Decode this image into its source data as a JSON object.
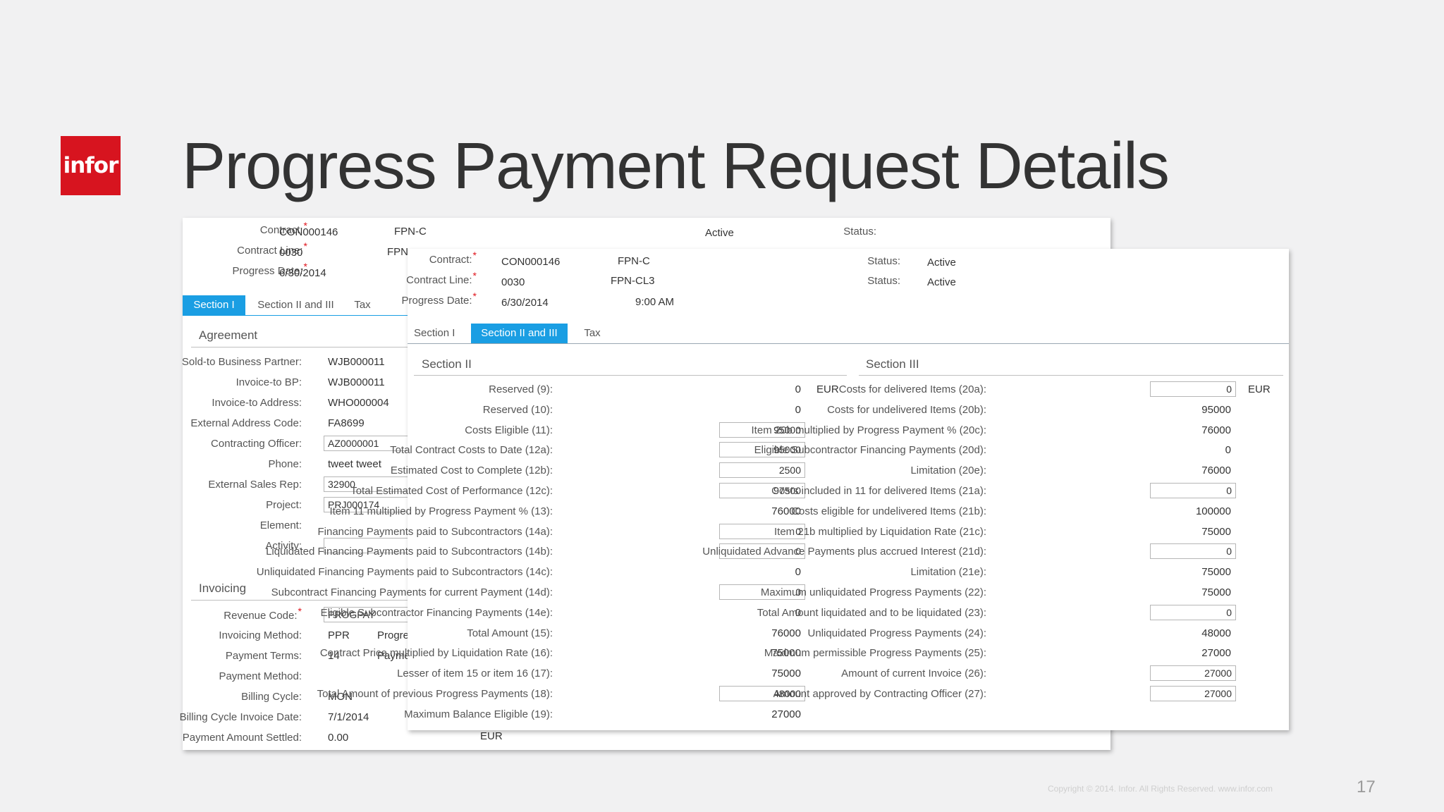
{
  "slide": {
    "logo": "infor",
    "title": "Progress Payment Request Details",
    "footer": "Copyright © 2014. Infor. All Rights Reserved. www.infor.com",
    "page_number": "17"
  },
  "back": {
    "header": {
      "contract_label": "Contract:",
      "contract": "CON000146",
      "contract_desc": "FPN-C",
      "line_label": "Contract Line:",
      "line": "0030",
      "line_desc": "FPN",
      "date_label": "Progress Date:",
      "date": "6/30/2014",
      "status_label": "Status:",
      "status": "Active"
    },
    "tabs": [
      "Section I",
      "Section II and III",
      "Tax"
    ],
    "agreement": {
      "heading": "Agreement",
      "rows": [
        {
          "label": "Sold-to Business Partner:",
          "value": "WJB000011"
        },
        {
          "label": "Invoice-to BP:",
          "value": "WJB000011"
        },
        {
          "label": "Invoice-to Address:",
          "value": "WHO000004"
        },
        {
          "label": "External Address Code:",
          "value": "FA8699"
        },
        {
          "label": "Contracting Officer:",
          "value": "AZ0000001"
        },
        {
          "label": "Phone:",
          "value": "tweet tweet"
        },
        {
          "label": "External Sales Rep:",
          "value": "32900"
        },
        {
          "label": "Project:",
          "value": "PRJ000174"
        },
        {
          "label": "Element:",
          "value": ""
        },
        {
          "label": "Activity:",
          "value": ""
        }
      ]
    },
    "invoicing": {
      "heading": "Invoicing",
      "rows": [
        {
          "label": "Revenue Code:",
          "value": "PROGPAY",
          "extra": ""
        },
        {
          "label": "Invoicing Method:",
          "value": "PPR",
          "extra": "Progre"
        },
        {
          "label": "Payment Terms:",
          "value": "14",
          "extra": "Payme"
        },
        {
          "label": "Payment Method:",
          "value": "",
          "extra": ""
        },
        {
          "label": "Billing Cycle:",
          "value": "MON",
          "extra": ""
        },
        {
          "label": "Billing Cycle Invoice Date:",
          "value": "7/1/2014",
          "extra": ""
        },
        {
          "label": "Payment Amount Settled:",
          "value": "0.00",
          "extra": ""
        }
      ],
      "currency": "EUR"
    }
  },
  "front": {
    "header": {
      "contract_label": "Contract:",
      "contract": "CON000146",
      "contract_desc": "FPN-C",
      "line_label": "Contract Line:",
      "line": "0030",
      "line_desc": "FPN-CL3",
      "date_label": "Progress Date:",
      "date": "6/30/2014",
      "time": "9:00 AM",
      "status_label": "Status:",
      "status1": "Active",
      "status2": "Active"
    },
    "tabs": [
      "Section I",
      "Section II and III",
      "Tax"
    ],
    "section2": {
      "heading": "Section II",
      "currency": "EUR",
      "rows": [
        {
          "label": "Reserved (9):",
          "value": "0",
          "input": false
        },
        {
          "label": "Reserved (10):",
          "value": "0",
          "input": false
        },
        {
          "label": "Costs Eligible (11):",
          "value": "95000",
          "input": true
        },
        {
          "label": "Total Contract Costs to Date (12a):",
          "value": "95000",
          "input": true
        },
        {
          "label": "Estimated Cost to Complete (12b):",
          "value": "2500",
          "input": true
        },
        {
          "label": "Total Estimated Cost of Performance (12c):",
          "value": "97500",
          "input": true
        },
        {
          "label": "Item 11 multiplied by Progress Payment % (13):",
          "value": "76000",
          "input": false
        },
        {
          "label": "Financing Payments paid to Subcontractors (14a):",
          "value": "0",
          "input": true
        },
        {
          "label": "Liquidated Financing Payments paid to Subcontractors (14b):",
          "value": "0",
          "input": true
        },
        {
          "label": "Unliquidated Financing Payments paid to Subcontractors (14c):",
          "value": "0",
          "input": false
        },
        {
          "label": "Subcontract Financing Payments for current Payment (14d):",
          "value": "0",
          "input": true
        },
        {
          "label": "Eligible Subcontractor Financing Payments (14e):",
          "value": "0",
          "input": false
        },
        {
          "label": "Total Amount (15):",
          "value": "76000",
          "input": false
        },
        {
          "label": "Contract Price multiplied by Liquidation Rate (16):",
          "value": "75000",
          "input": false
        },
        {
          "label": "Lesser of item 15 or item 16 (17):",
          "value": "75000",
          "input": false
        },
        {
          "label": "Total Amount of previous Progress Payments (18):",
          "value": "48000",
          "input": true
        },
        {
          "label": "Maximum Balance Eligible (19):",
          "value": "27000",
          "input": false
        }
      ]
    },
    "section3": {
      "heading": "Section III",
      "currency": "EUR",
      "rows": [
        {
          "label": "Costs for delivered Items (20a):",
          "value": "0",
          "input": true
        },
        {
          "label": "Costs for undelivered Items (20b):",
          "value": "95000",
          "input": false
        },
        {
          "label": "Item 20b multiplied by Progress Payment % (20c):",
          "value": "76000",
          "input": false
        },
        {
          "label": "Eligible Subcontractor Financing Payments (20d):",
          "value": "0",
          "input": false
        },
        {
          "label": "Limitation (20e):",
          "value": "76000",
          "input": false
        },
        {
          "label": "Costs included in 11 for delivered Items (21a):",
          "value": "0",
          "input": true
        },
        {
          "label": "Costs eligible for undelivered Items (21b):",
          "value": "100000",
          "input": false
        },
        {
          "label": "Item 21b multiplied by Liquidation Rate (21c):",
          "value": "75000",
          "input": false
        },
        {
          "label": "Unliquidated Advance Payments plus accrued Interest (21d):",
          "value": "0",
          "input": true
        },
        {
          "label": "Limitation (21e):",
          "value": "75000",
          "input": false
        },
        {
          "label": "Maximum unliquidated Progress Payments (22):",
          "value": "75000",
          "input": false
        },
        {
          "label": "Total Amount liquidated and to be liquidated (23):",
          "value": "0",
          "input": true
        },
        {
          "label": "Unliquidated Progress Payments (24):",
          "value": "48000",
          "input": false
        },
        {
          "label": "Maximum permissible Progress Payments (25):",
          "value": "27000",
          "input": false
        },
        {
          "label": "Amount of current Invoice (26):",
          "value": "27000",
          "input": true
        },
        {
          "label": "Amount approved by Contracting Officer (27):",
          "value": "27000",
          "input": true
        }
      ]
    }
  }
}
